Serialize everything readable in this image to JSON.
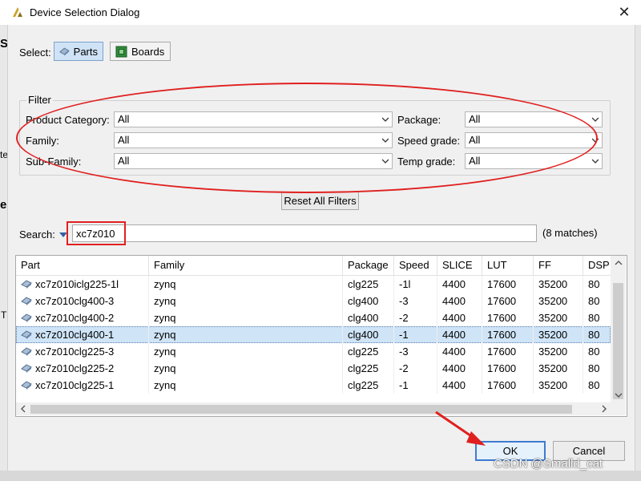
{
  "window": {
    "title": "Device Selection Dialog",
    "close_icon": "close-icon"
  },
  "select": {
    "label": "Select:",
    "parts_label": "Parts",
    "boards_label": "Boards",
    "active": "Parts"
  },
  "filter": {
    "title": "Filter",
    "left": [
      {
        "label": "Product Category:",
        "value": "All"
      },
      {
        "label": "Family:",
        "value": "All"
      },
      {
        "label": "Sub-Family:",
        "value": "All"
      }
    ],
    "right": [
      {
        "label": "Package:",
        "value": "All"
      },
      {
        "label": "Speed grade:",
        "value": "All"
      },
      {
        "label": "Temp grade:",
        "value": "All"
      }
    ],
    "reset_label": "Reset All Filters"
  },
  "search": {
    "label": "Search:",
    "value": "xc7z010",
    "matches": "(8 matches)"
  },
  "table": {
    "columns": [
      "Part",
      "Family",
      "Package",
      "Speed",
      "SLICE",
      "LUT",
      "FF",
      "DSP"
    ],
    "rows": [
      [
        "xc7z010iclg225-1l",
        "zynq",
        "clg225",
        "-1l",
        "4400",
        "17600",
        "35200",
        "80"
      ],
      [
        "xc7z010clg400-3",
        "zynq",
        "clg400",
        "-3",
        "4400",
        "17600",
        "35200",
        "80"
      ],
      [
        "xc7z010clg400-2",
        "zynq",
        "clg400",
        "-2",
        "4400",
        "17600",
        "35200",
        "80"
      ],
      [
        "xc7z010clg400-1",
        "zynq",
        "clg400",
        "-1",
        "4400",
        "17600",
        "35200",
        "80"
      ],
      [
        "xc7z010clg225-3",
        "zynq",
        "clg225",
        "-3",
        "4400",
        "17600",
        "35200",
        "80"
      ],
      [
        "xc7z010clg225-2",
        "zynq",
        "clg225",
        "-2",
        "4400",
        "17600",
        "35200",
        "80"
      ],
      [
        "xc7z010clg225-1",
        "zynq",
        "clg225",
        "-1",
        "4400",
        "17600",
        "35200",
        "80"
      ]
    ],
    "selected_row": 3
  },
  "buttons": {
    "ok": "OK",
    "cancel": "Cancel"
  },
  "watermark": "CSDN @Smalld_cat",
  "background_fragments": {
    "top_char": "St",
    "mid_char": "e",
    "side_char": "te",
    "low_char": "T"
  },
  "colors": {
    "annotation": "#e02020",
    "selection": "#cfe4f7",
    "ok_border": "#3d7bd0"
  }
}
